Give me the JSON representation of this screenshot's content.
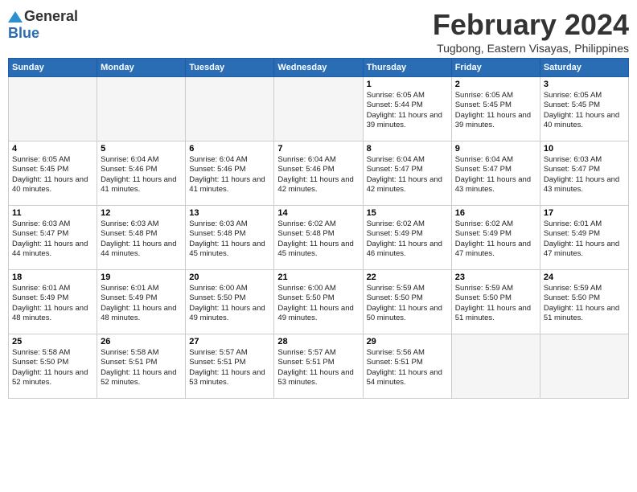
{
  "header": {
    "logo_general": "General",
    "logo_blue": "Blue",
    "month_title": "February 2024",
    "location": "Tugbong, Eastern Visayas, Philippines"
  },
  "weekdays": [
    "Sunday",
    "Monday",
    "Tuesday",
    "Wednesday",
    "Thursday",
    "Friday",
    "Saturday"
  ],
  "weeks": [
    [
      {
        "day": "",
        "sunrise": "",
        "sunset": "",
        "daylight": "",
        "empty": true
      },
      {
        "day": "",
        "sunrise": "",
        "sunset": "",
        "daylight": "",
        "empty": true
      },
      {
        "day": "",
        "sunrise": "",
        "sunset": "",
        "daylight": "",
        "empty": true
      },
      {
        "day": "",
        "sunrise": "",
        "sunset": "",
        "daylight": "",
        "empty": true
      },
      {
        "day": "1",
        "sunrise": "Sunrise: 6:05 AM",
        "sunset": "Sunset: 5:44 PM",
        "daylight": "Daylight: 11 hours and 39 minutes.",
        "empty": false
      },
      {
        "day": "2",
        "sunrise": "Sunrise: 6:05 AM",
        "sunset": "Sunset: 5:45 PM",
        "daylight": "Daylight: 11 hours and 39 minutes.",
        "empty": false
      },
      {
        "day": "3",
        "sunrise": "Sunrise: 6:05 AM",
        "sunset": "Sunset: 5:45 PM",
        "daylight": "Daylight: 11 hours and 40 minutes.",
        "empty": false
      }
    ],
    [
      {
        "day": "4",
        "sunrise": "Sunrise: 6:05 AM",
        "sunset": "Sunset: 5:45 PM",
        "daylight": "Daylight: 11 hours and 40 minutes.",
        "empty": false
      },
      {
        "day": "5",
        "sunrise": "Sunrise: 6:04 AM",
        "sunset": "Sunset: 5:46 PM",
        "daylight": "Daylight: 11 hours and 41 minutes.",
        "empty": false
      },
      {
        "day": "6",
        "sunrise": "Sunrise: 6:04 AM",
        "sunset": "Sunset: 5:46 PM",
        "daylight": "Daylight: 11 hours and 41 minutes.",
        "empty": false
      },
      {
        "day": "7",
        "sunrise": "Sunrise: 6:04 AM",
        "sunset": "Sunset: 5:46 PM",
        "daylight": "Daylight: 11 hours and 42 minutes.",
        "empty": false
      },
      {
        "day": "8",
        "sunrise": "Sunrise: 6:04 AM",
        "sunset": "Sunset: 5:47 PM",
        "daylight": "Daylight: 11 hours and 42 minutes.",
        "empty": false
      },
      {
        "day": "9",
        "sunrise": "Sunrise: 6:04 AM",
        "sunset": "Sunset: 5:47 PM",
        "daylight": "Daylight: 11 hours and 43 minutes.",
        "empty": false
      },
      {
        "day": "10",
        "sunrise": "Sunrise: 6:03 AM",
        "sunset": "Sunset: 5:47 PM",
        "daylight": "Daylight: 11 hours and 43 minutes.",
        "empty": false
      }
    ],
    [
      {
        "day": "11",
        "sunrise": "Sunrise: 6:03 AM",
        "sunset": "Sunset: 5:47 PM",
        "daylight": "Daylight: 11 hours and 44 minutes.",
        "empty": false
      },
      {
        "day": "12",
        "sunrise": "Sunrise: 6:03 AM",
        "sunset": "Sunset: 5:48 PM",
        "daylight": "Daylight: 11 hours and 44 minutes.",
        "empty": false
      },
      {
        "day": "13",
        "sunrise": "Sunrise: 6:03 AM",
        "sunset": "Sunset: 5:48 PM",
        "daylight": "Daylight: 11 hours and 45 minutes.",
        "empty": false
      },
      {
        "day": "14",
        "sunrise": "Sunrise: 6:02 AM",
        "sunset": "Sunset: 5:48 PM",
        "daylight": "Daylight: 11 hours and 45 minutes.",
        "empty": false
      },
      {
        "day": "15",
        "sunrise": "Sunrise: 6:02 AM",
        "sunset": "Sunset: 5:49 PM",
        "daylight": "Daylight: 11 hours and 46 minutes.",
        "empty": false
      },
      {
        "day": "16",
        "sunrise": "Sunrise: 6:02 AM",
        "sunset": "Sunset: 5:49 PM",
        "daylight": "Daylight: 11 hours and 47 minutes.",
        "empty": false
      },
      {
        "day": "17",
        "sunrise": "Sunrise: 6:01 AM",
        "sunset": "Sunset: 5:49 PM",
        "daylight": "Daylight: 11 hours and 47 minutes.",
        "empty": false
      }
    ],
    [
      {
        "day": "18",
        "sunrise": "Sunrise: 6:01 AM",
        "sunset": "Sunset: 5:49 PM",
        "daylight": "Daylight: 11 hours and 48 minutes.",
        "empty": false
      },
      {
        "day": "19",
        "sunrise": "Sunrise: 6:01 AM",
        "sunset": "Sunset: 5:49 PM",
        "daylight": "Daylight: 11 hours and 48 minutes.",
        "empty": false
      },
      {
        "day": "20",
        "sunrise": "Sunrise: 6:00 AM",
        "sunset": "Sunset: 5:50 PM",
        "daylight": "Daylight: 11 hours and 49 minutes.",
        "empty": false
      },
      {
        "day": "21",
        "sunrise": "Sunrise: 6:00 AM",
        "sunset": "Sunset: 5:50 PM",
        "daylight": "Daylight: 11 hours and 49 minutes.",
        "empty": false
      },
      {
        "day": "22",
        "sunrise": "Sunrise: 5:59 AM",
        "sunset": "Sunset: 5:50 PM",
        "daylight": "Daylight: 11 hours and 50 minutes.",
        "empty": false
      },
      {
        "day": "23",
        "sunrise": "Sunrise: 5:59 AM",
        "sunset": "Sunset: 5:50 PM",
        "daylight": "Daylight: 11 hours and 51 minutes.",
        "empty": false
      },
      {
        "day": "24",
        "sunrise": "Sunrise: 5:59 AM",
        "sunset": "Sunset: 5:50 PM",
        "daylight": "Daylight: 11 hours and 51 minutes.",
        "empty": false
      }
    ],
    [
      {
        "day": "25",
        "sunrise": "Sunrise: 5:58 AM",
        "sunset": "Sunset: 5:50 PM",
        "daylight": "Daylight: 11 hours and 52 minutes.",
        "empty": false
      },
      {
        "day": "26",
        "sunrise": "Sunrise: 5:58 AM",
        "sunset": "Sunset: 5:51 PM",
        "daylight": "Daylight: 11 hours and 52 minutes.",
        "empty": false
      },
      {
        "day": "27",
        "sunrise": "Sunrise: 5:57 AM",
        "sunset": "Sunset: 5:51 PM",
        "daylight": "Daylight: 11 hours and 53 minutes.",
        "empty": false
      },
      {
        "day": "28",
        "sunrise": "Sunrise: 5:57 AM",
        "sunset": "Sunset: 5:51 PM",
        "daylight": "Daylight: 11 hours and 53 minutes.",
        "empty": false
      },
      {
        "day": "29",
        "sunrise": "Sunrise: 5:56 AM",
        "sunset": "Sunset: 5:51 PM",
        "daylight": "Daylight: 11 hours and 54 minutes.",
        "empty": false
      },
      {
        "day": "",
        "sunrise": "",
        "sunset": "",
        "daylight": "",
        "empty": true
      },
      {
        "day": "",
        "sunrise": "",
        "sunset": "",
        "daylight": "",
        "empty": true
      }
    ]
  ]
}
